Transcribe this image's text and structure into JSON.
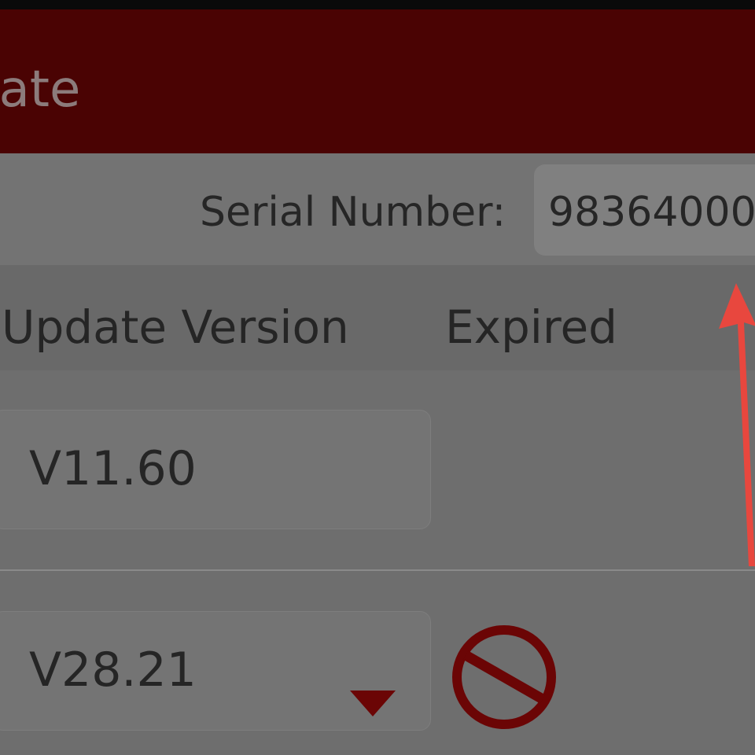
{
  "title_bar": {
    "title": "date",
    "background_color": "#4a0303"
  },
  "serial": {
    "label": "Serial Number:",
    "value": "98364000"
  },
  "table_header": {
    "update_version": "Update Version",
    "expired": "Expired"
  },
  "rows": [
    {
      "version": "V11.60",
      "has_dropdown": false,
      "expired_icon": null
    },
    {
      "version": "V28.21",
      "has_dropdown": true,
      "expired_icon": "prohibited-icon"
    }
  ],
  "colors": {
    "accent_red": "#6b0505",
    "annotation_arrow": "#e8473e"
  },
  "icons": {
    "dropdown": "dropdown-caret-icon",
    "annotation": "red-arrow-annotation"
  }
}
